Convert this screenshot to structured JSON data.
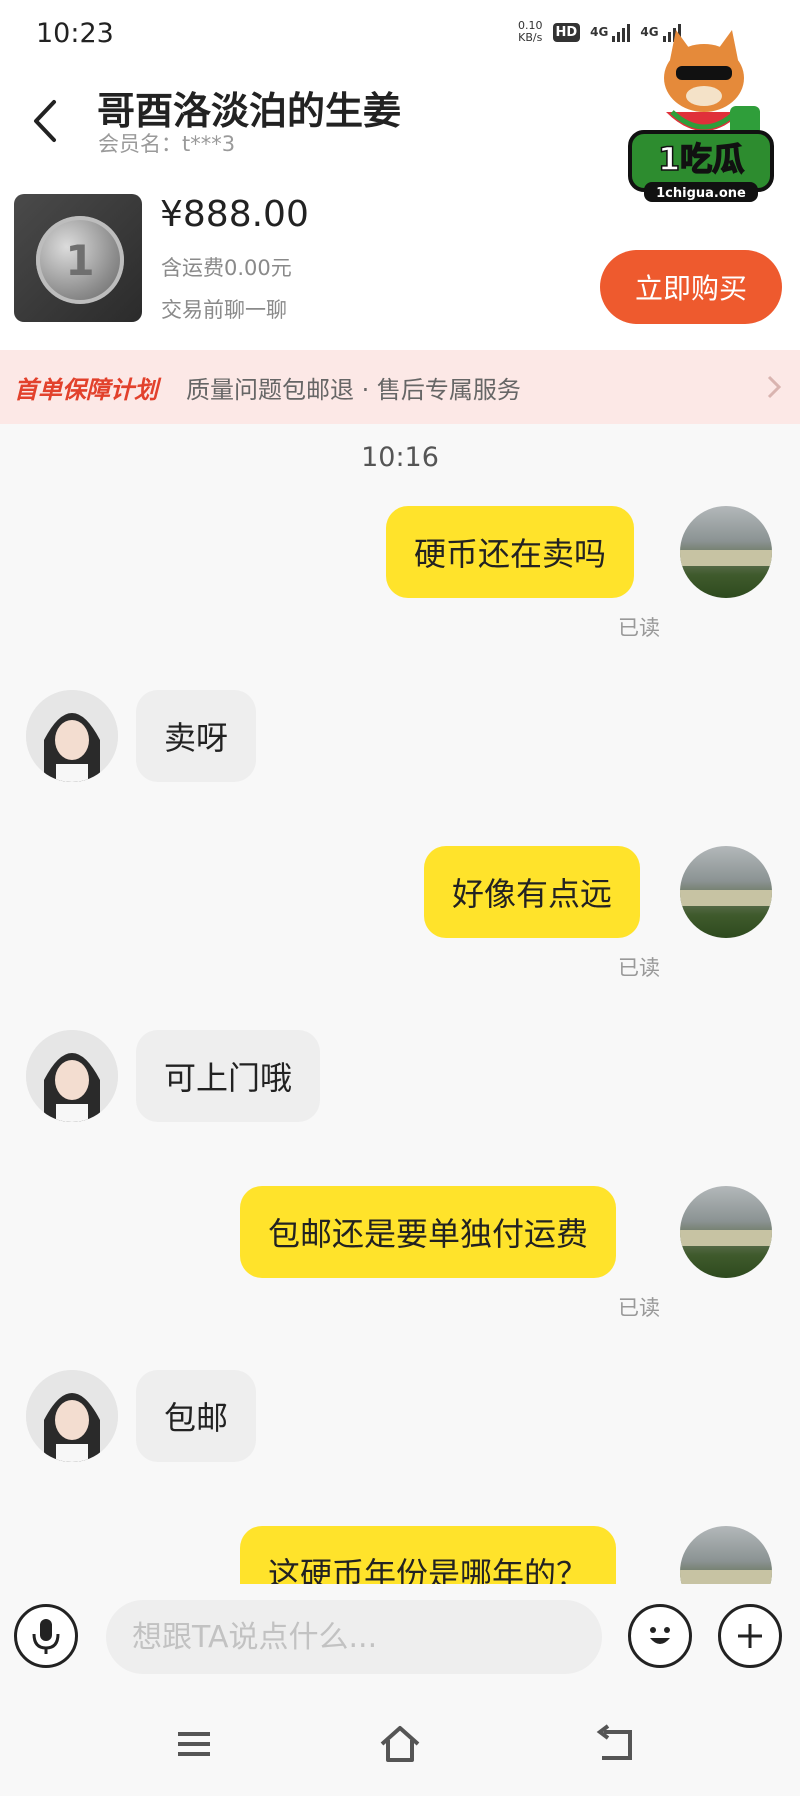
{
  "status_bar": {
    "time": "10:23",
    "net_speed_value": "0.10",
    "net_speed_unit": "KB/s",
    "hd_badge": "HD",
    "sim1_label": "4G",
    "sim2_label": "4G"
  },
  "header": {
    "title": "哥酉洛淡泊的生姜",
    "member_label": "会员名：t***3"
  },
  "watermark": {
    "brand": "1吃瓜",
    "site": "1chigua.one"
  },
  "product": {
    "price": "¥888.00",
    "shipping": "含运费0.00元",
    "note": "交易前聊一聊",
    "coin_numeral": "1",
    "buy_label": "立即购买"
  },
  "banner": {
    "title": "首单保障计划",
    "desc": "质量问题包邮退 · 售后专属服务"
  },
  "chat": {
    "time": "10:16",
    "messages": [
      {
        "side": "out",
        "text": "硬币还在卖吗",
        "read": "已读"
      },
      {
        "side": "in",
        "text": "卖呀"
      },
      {
        "side": "out",
        "text": "好像有点远",
        "read": "已读"
      },
      {
        "side": "in",
        "text": "可上门哦"
      },
      {
        "side": "out",
        "text": "包邮还是要单独付运费",
        "read": "已读"
      },
      {
        "side": "in",
        "text": "包邮"
      },
      {
        "side": "out",
        "text": "这硬币年份是哪年的？"
      }
    ]
  },
  "input": {
    "placeholder": "想跟TA说点什么..."
  },
  "colors": {
    "outgoing_bubble": "#ffe32b",
    "incoming_bubble": "#eeeeee",
    "buy_button": "#ee5a2e",
    "banner_bg": "#fce8e6",
    "banner_title": "#e2412c"
  },
  "icons": {
    "back": "chevron-left-icon",
    "mic": "microphone-icon",
    "emoji": "smiley-icon",
    "plus": "plus-icon",
    "nav_menu": "menu-icon",
    "nav_home": "home-icon",
    "nav_back": "return-icon"
  }
}
